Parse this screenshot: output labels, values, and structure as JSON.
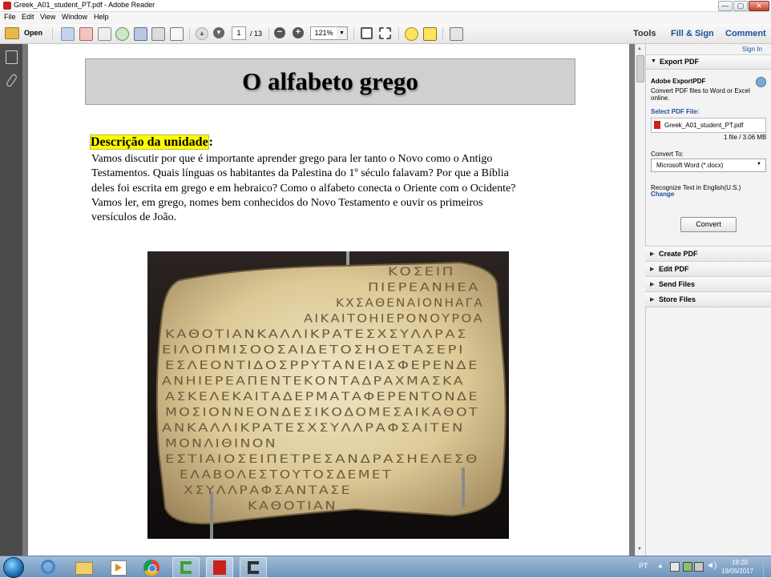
{
  "window": {
    "title": "Greek_A01_student_PT.pdf - Adobe Reader",
    "controls": [
      "—",
      "▢",
      "✕"
    ]
  },
  "menu": [
    "File",
    "Edit",
    "View",
    "Window",
    "Help"
  ],
  "toolbar": {
    "open_label": "Open",
    "page_current": "1",
    "page_total": "/ 13",
    "zoom": "121%",
    "tools_label": "Tools",
    "fillsign_label": "Fill & Sign",
    "comment_label": "Comment"
  },
  "document": {
    "title": "O alfabeto grego",
    "heading": "Descrição da unidade",
    "heading_suffix": ":",
    "body_lines": [
      "Vamos discutir por que é importante aprender grego para ler tanto o Novo como o Antigo",
      "Testamentos. Quais línguas os habitantes da Palestina do 1º século falavam? Por que a Bíblia",
      "deles foi escrita em grego e em hebraico? Como o alfabeto conecta o Oriente com o Ocidente?",
      "Vamos ler, em grego, nomes bem conhecidos do Novo Testamento e ouvir os primeiros",
      "versículos de João."
    ],
    "inscription_lines": [
      "ΚΟΣΕΙΠ",
      "ΠΙΕΡΕΑΝΗΕΑ",
      "ΚΧΣΑΘΕΝΑΙΟΝΗΑΓΑ",
      "ΑΙΚΑΙΤΟΗΙΕΡΟΝΟΥΡΟΑ",
      "ΚΑΘΟΤΙΑΝΚΑΛΛΙΚΡΑΤΕΣΧΣΥΛΛΡΑΣ",
      "ΕΙΛΟΠΜΙΣΟΟΣΑΙΔΕΤΟΣΗΟΕΤΑΣΕΡΙ",
      "ΕΣΛΕΟΝΤΙΔΟΣΡΡΥΤΑΝΕΙΑΣΦΕΡΕΝΔΕ",
      "ΑΝΗΙΕΡΕΑΠΕΝΤΕΚΟΝΤΑΔΡΑΧΜΑΣΚΑ",
      "ΑΣΚΕΛΕΚΑΙΤΑΔΕΡΜΑΤΑΦΕΡΕΝΤΟΝΔΕ",
      "ΜΟΣΙΟΝΝΕΟΝΔΕΣΙΚΟΔΟΜΕΣΑΙΚΑΘΟΤ",
      "ΑΝΚΑΛΛΙΚΡΑΤΕΣΧΣΥΛΛΡΑΦΣΑΙΤΕΝ",
      "ΜΟΝΛΙΘΙΝΟΝ",
      "ΕΣΤΙΑΙΟΣΕΙΠΕΤΡΕΣΑΝΔΡΑΣΗΕΛΕΣΘ",
      "ΕΛΑΒΟΛΕΣΤΟΥΤΟΣΔΕΜΕΤ",
      "ΧΣΥΛΛΡΑΦΣΑΝΤΑΣΕ",
      "ΚΑΘΟΤΙΑΝ"
    ]
  },
  "right_pane": {
    "signin": "Sign In",
    "export_header": "Export PDF",
    "adobe_exportpdf": "Adobe ExportPDF",
    "convert_desc_1": "Convert PDF files to Word or Excel",
    "convert_desc_2": "online.",
    "select_label": "Select PDF File:",
    "file_name": "Greek_A01_student_PT.pdf",
    "file_count": "1 file / 3.06 MB",
    "convert_to_label": "Convert To:",
    "convert_to_value": "Microsoft Word (*.docx)",
    "recognize_text": "Recognize Text in English(U.S.)",
    "change_link": "Change",
    "convert_button": "Convert",
    "sections": [
      "Create PDF",
      "Edit PDF",
      "Send Files",
      "Store Files"
    ]
  },
  "taskbar": {
    "language": "PT",
    "time": "18:20",
    "date": "19/05/2017"
  },
  "colors": {
    "title_highlight": "#ffff00",
    "link_blue": "#1d4f9c",
    "pdf_red": "#c9211e",
    "taskbar": "#7aa0c6"
  }
}
